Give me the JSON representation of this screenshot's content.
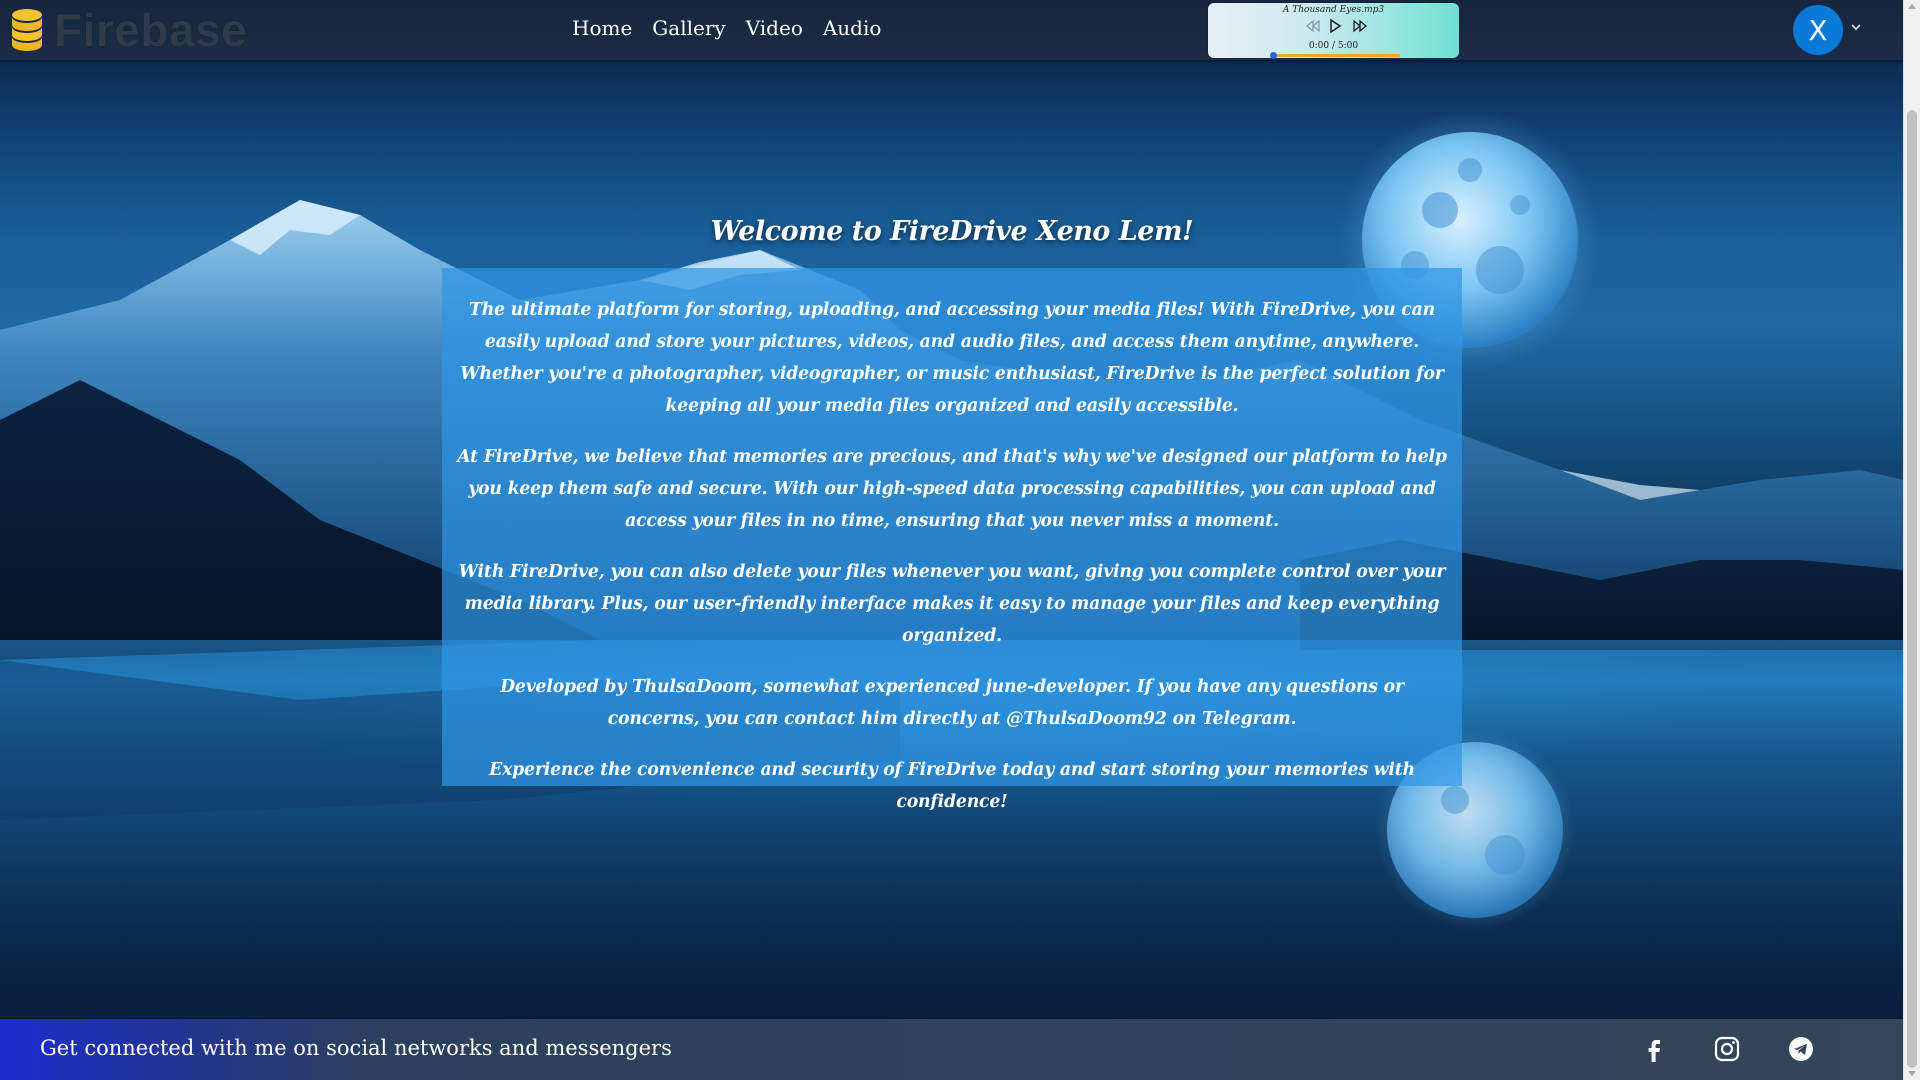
{
  "navbar": {
    "brand": "Firebase",
    "links": [
      "Home",
      "Gallery",
      "Video",
      "Audio"
    ]
  },
  "player": {
    "track": "A Thousand Eyes.mp3",
    "time": "0:00 / 5:00",
    "progress": 0
  },
  "user": {
    "initial": "X"
  },
  "main": {
    "title": "Welcome to FireDrive Xeno Lem!",
    "paragraphs": [
      "The ultimate platform for storing, uploading, and accessing your media files! With FireDrive, you can easily upload and store your pictures, videos, and audio files, and access them anytime, anywhere. Whether you're a photographer, videographer, or music enthusiast, FireDrive is the perfect solution for keeping all your media files organized and easily accessible.",
      "At FireDrive, we believe that memories are precious, and that's why we've designed our platform to help you keep them safe and secure. With our high-speed data processing capabilities, you can upload and access your files in no time, ensuring that you never miss a moment.",
      "With FireDrive, you can also delete your files whenever you want, giving you complete control over your media library. Plus, our user-friendly interface makes it easy to manage your files and keep everything organized.",
      "Developed by ThulsaDoom, somewhat experienced june-developer. If you have any questions or concerns, you can contact him directly at @ThulsaDoom92 on Telegram.",
      "Experience the convenience and security of FireDrive today and start storing your memories with confidence!"
    ]
  },
  "footer": {
    "text": "Get connected with me on social networks and messengers",
    "socials": [
      "facebook-icon",
      "instagram-icon",
      "telegram-icon"
    ]
  },
  "colors": {
    "navbar": "#1b2d47",
    "card": "#2f96e4",
    "avatar": "#0a7ad8",
    "footer_accent": "#1e2cd0"
  }
}
